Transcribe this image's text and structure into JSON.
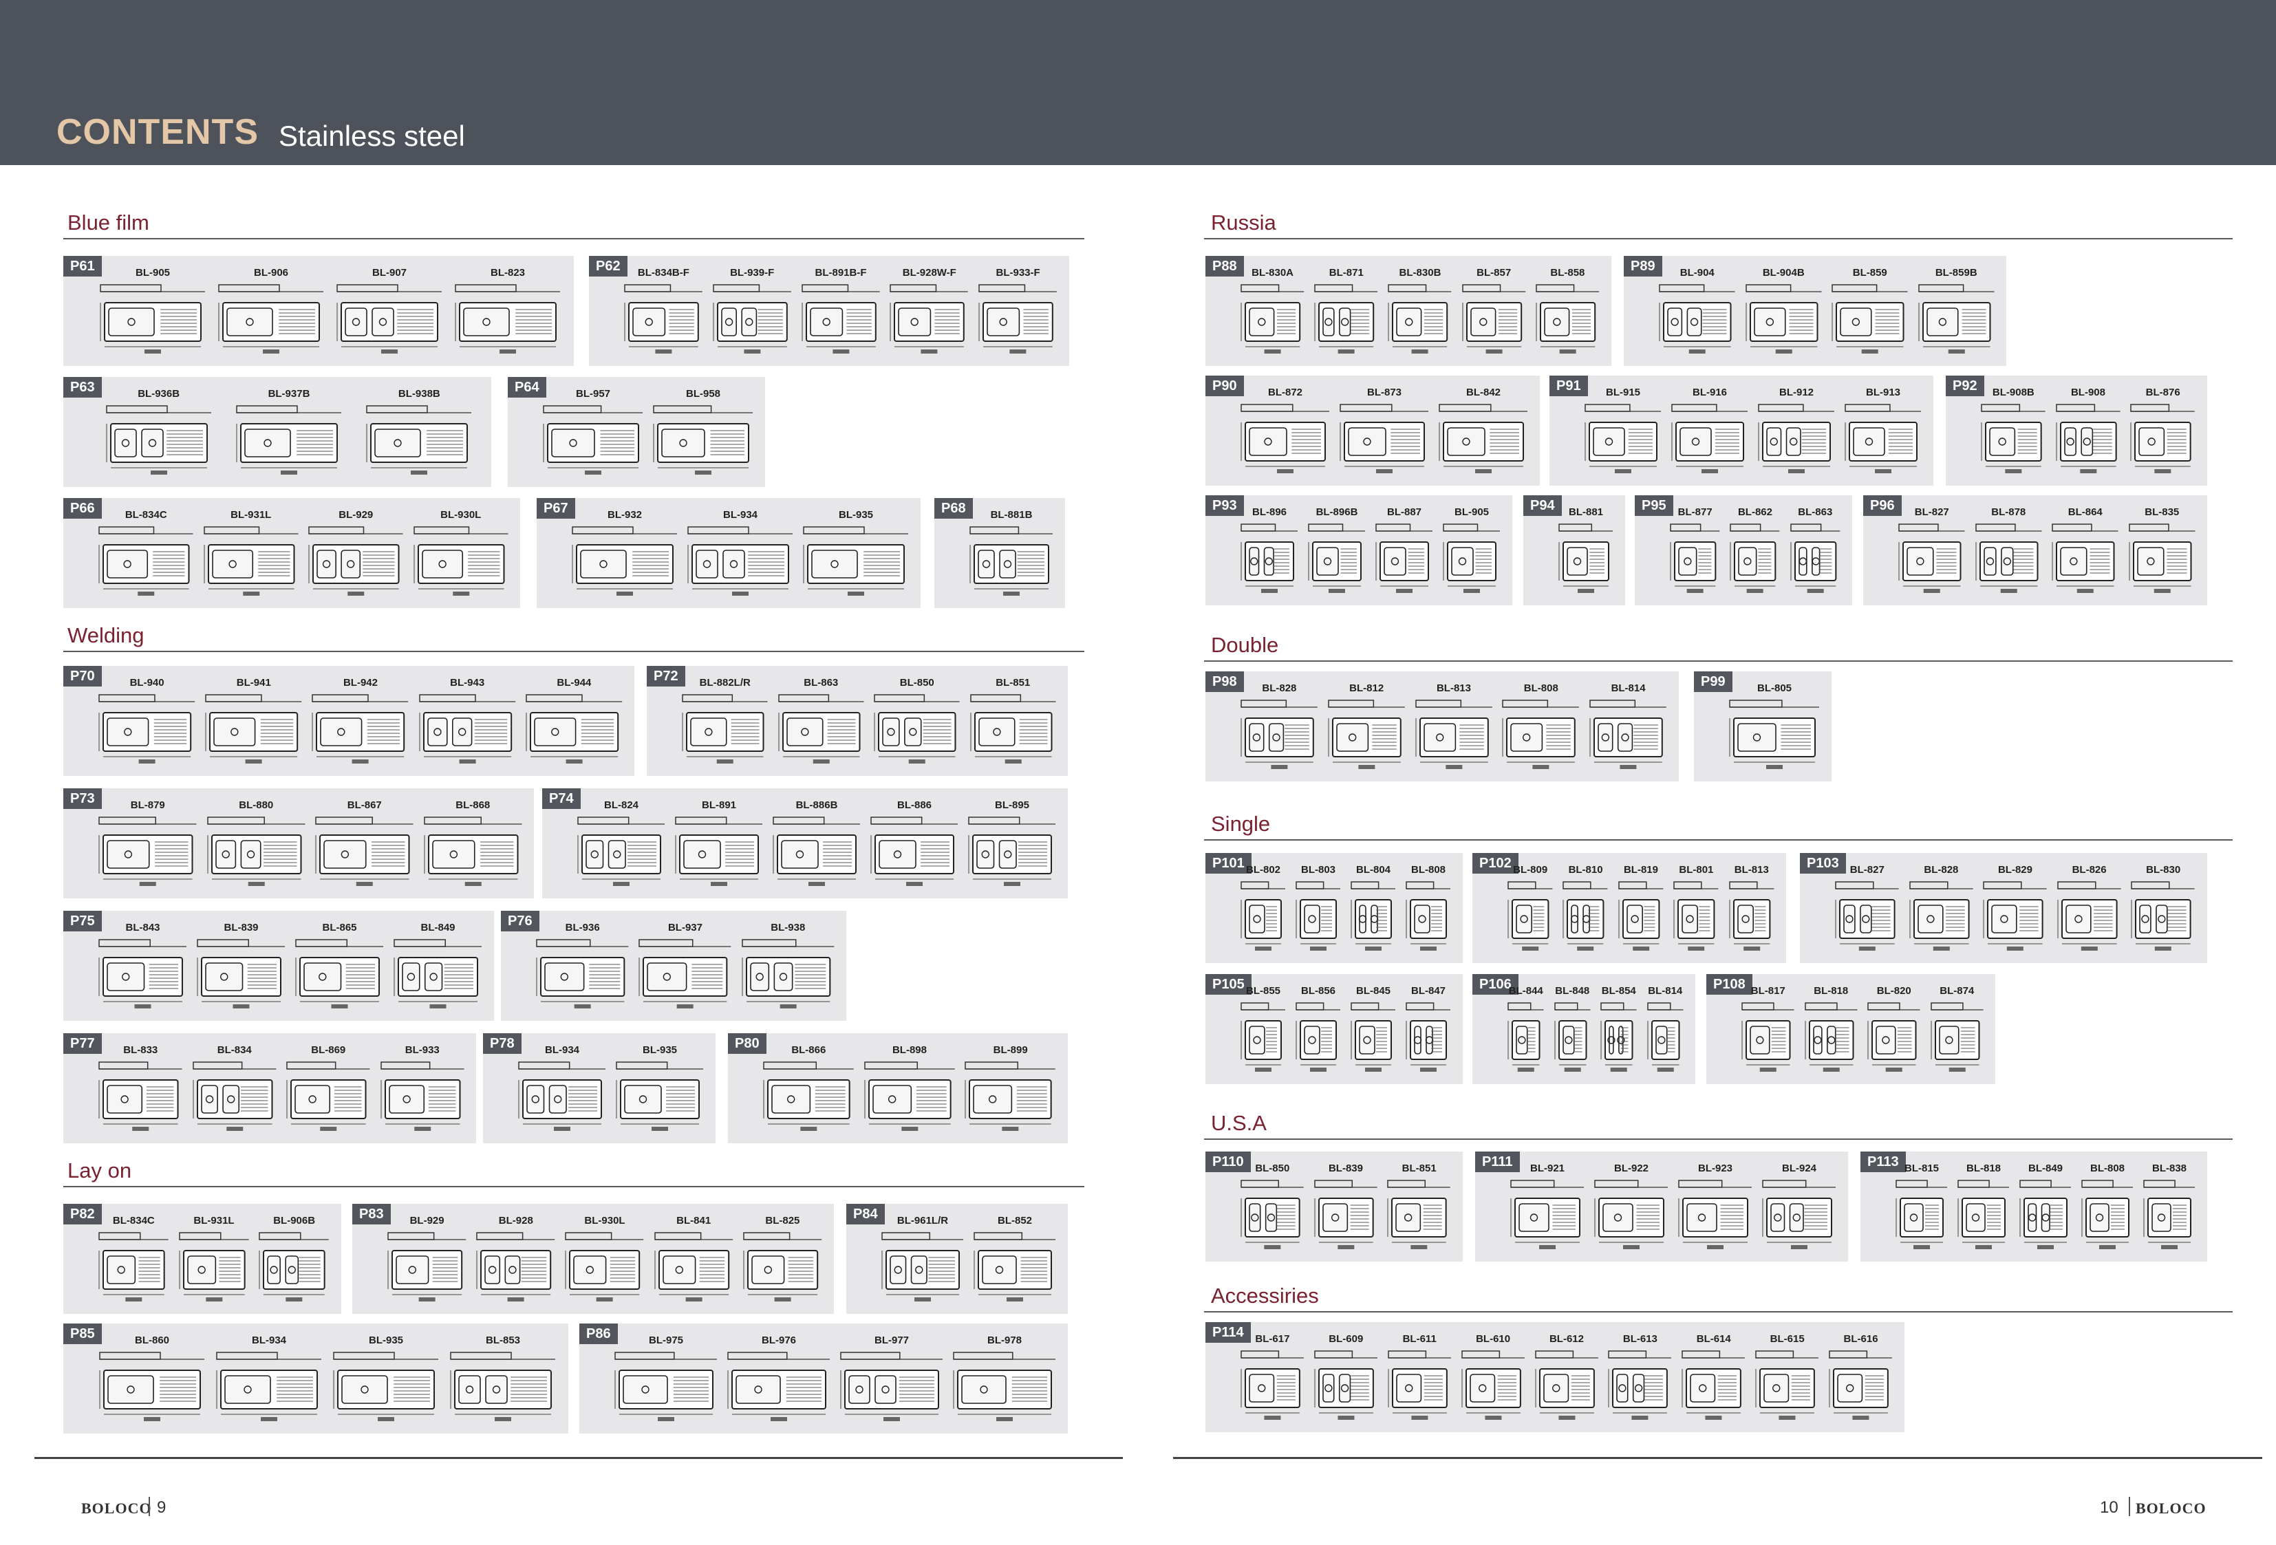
{
  "header": {
    "title": "CONTENTS",
    "subtitle": "Stainless steel"
  },
  "sections": [
    "Blue film",
    "Welding",
    "Lay on",
    "Russia",
    "Double",
    "Single",
    "U.S.A",
    "Accessiries"
  ],
  "panels": [
    {
      "tag": "P61",
      "items": [
        "BL-905",
        "BL-906",
        "BL-907",
        "BL-823"
      ]
    },
    {
      "tag": "P62",
      "items": [
        "BL-834B-F",
        "BL-939-F",
        "BL-891B-F",
        "BL-928W-F",
        "BL-933-F"
      ]
    },
    {
      "tag": "P63",
      "items": [
        "BL-936B",
        "BL-937B",
        "BL-938B"
      ]
    },
    {
      "tag": "P64",
      "items": [
        "BL-957",
        "BL-958"
      ]
    },
    {
      "tag": "P66",
      "items": [
        "BL-834C",
        "BL-931L",
        "BL-929",
        "BL-930L"
      ]
    },
    {
      "tag": "P67",
      "items": [
        "BL-932",
        "BL-934",
        "BL-935"
      ]
    },
    {
      "tag": "P68",
      "items": [
        "BL-881B"
      ]
    },
    {
      "tag": "P70",
      "items": [
        "BL-940",
        "BL-941",
        "BL-942",
        "BL-943",
        "BL-944"
      ]
    },
    {
      "tag": "P72",
      "items": [
        "BL-882L/R",
        "BL-863",
        "BL-850",
        "BL-851"
      ]
    },
    {
      "tag": "P73",
      "items": [
        "BL-879",
        "BL-880",
        "BL-867",
        "BL-868"
      ]
    },
    {
      "tag": "P74",
      "items": [
        "BL-824",
        "BL-891",
        "BL-886B",
        "BL-886",
        "BL-895"
      ]
    },
    {
      "tag": "P75",
      "items": [
        "BL-843",
        "BL-839",
        "BL-865",
        "BL-849"
      ]
    },
    {
      "tag": "P76",
      "items": [
        "BL-936",
        "BL-937",
        "BL-938"
      ]
    },
    {
      "tag": "P77",
      "items": [
        "BL-833",
        "BL-834",
        "BL-869",
        "BL-933"
      ]
    },
    {
      "tag": "P78",
      "items": [
        "BL-934",
        "BL-935"
      ]
    },
    {
      "tag": "P80",
      "items": [
        "BL-866",
        "BL-898",
        "BL-899"
      ]
    },
    {
      "tag": "P82",
      "items": [
        "BL-834C",
        "BL-931L",
        "BL-906B"
      ]
    },
    {
      "tag": "P83",
      "items": [
        "BL-929",
        "BL-928",
        "BL-930L",
        "BL-841",
        "BL-825"
      ]
    },
    {
      "tag": "P84",
      "items": [
        "BL-961L/R",
        "BL-852"
      ]
    },
    {
      "tag": "P85",
      "items": [
        "BL-860",
        "BL-934",
        "BL-935",
        "BL-853"
      ]
    },
    {
      "tag": "P86",
      "items": [
        "BL-975",
        "BL-976",
        "BL-977",
        "BL-978"
      ]
    },
    {
      "tag": "P88",
      "items": [
        "BL-830A",
        "BL-871",
        "BL-830B",
        "BL-857",
        "BL-858"
      ]
    },
    {
      "tag": "P89",
      "items": [
        "BL-904",
        "BL-904B",
        "BL-859",
        "BL-859B"
      ]
    },
    {
      "tag": "P90",
      "items": [
        "BL-872",
        "BL-873",
        "BL-842"
      ]
    },
    {
      "tag": "P91",
      "items": [
        "BL-915",
        "BL-916",
        "BL-912",
        "BL-913"
      ]
    },
    {
      "tag": "P92",
      "items": [
        "BL-908B",
        "BL-908",
        "BL-876"
      ]
    },
    {
      "tag": "P93",
      "items": [
        "BL-896",
        "BL-896B",
        "BL-887",
        "BL-905"
      ]
    },
    {
      "tag": "P94",
      "items": [
        "BL-881"
      ]
    },
    {
      "tag": "P95",
      "items": [
        "BL-877",
        "BL-862",
        "BL-863"
      ]
    },
    {
      "tag": "P96",
      "items": [
        "BL-827",
        "BL-878",
        "BL-864",
        "BL-835"
      ]
    },
    {
      "tag": "P98",
      "items": [
        "BL-828",
        "BL-812",
        "BL-813",
        "BL-808",
        "BL-814"
      ]
    },
    {
      "tag": "P99",
      "items": [
        "BL-805"
      ]
    },
    {
      "tag": "P101",
      "items": [
        "BL-802",
        "BL-803",
        "BL-804",
        "BL-808"
      ]
    },
    {
      "tag": "P102",
      "items": [
        "BL-809",
        "BL-810",
        "BL-819",
        "BL-801",
        "BL-813"
      ]
    },
    {
      "tag": "P103",
      "items": [
        "BL-827",
        "BL-828",
        "BL-829",
        "BL-826",
        "BL-830"
      ]
    },
    {
      "tag": "P105",
      "items": [
        "BL-855",
        "BL-856",
        "BL-845",
        "BL-847"
      ]
    },
    {
      "tag": "P106",
      "items": [
        "BL-844",
        "BL-848",
        "BL-854",
        "BL-814"
      ]
    },
    {
      "tag": "P108",
      "items": [
        "BL-817",
        "BL-818",
        "BL-820",
        "BL-874"
      ]
    },
    {
      "tag": "P110",
      "items": [
        "BL-850",
        "BL-839",
        "BL-851"
      ]
    },
    {
      "tag": "P111",
      "items": [
        "BL-921",
        "BL-922",
        "BL-923",
        "BL-924"
      ]
    },
    {
      "tag": "P113",
      "items": [
        "BL-815",
        "BL-818",
        "BL-849",
        "BL-808",
        "BL-838"
      ]
    },
    {
      "tag": "P114",
      "items": [
        "BL-617",
        "BL-609",
        "BL-611",
        "BL-610",
        "BL-612",
        "BL-613",
        "BL-614",
        "BL-615",
        "BL-616"
      ]
    }
  ],
  "footer": {
    "left_brand": "BOLOCO",
    "left_page": "9",
    "right_page": "10",
    "right_brand": "BOLOCO"
  }
}
